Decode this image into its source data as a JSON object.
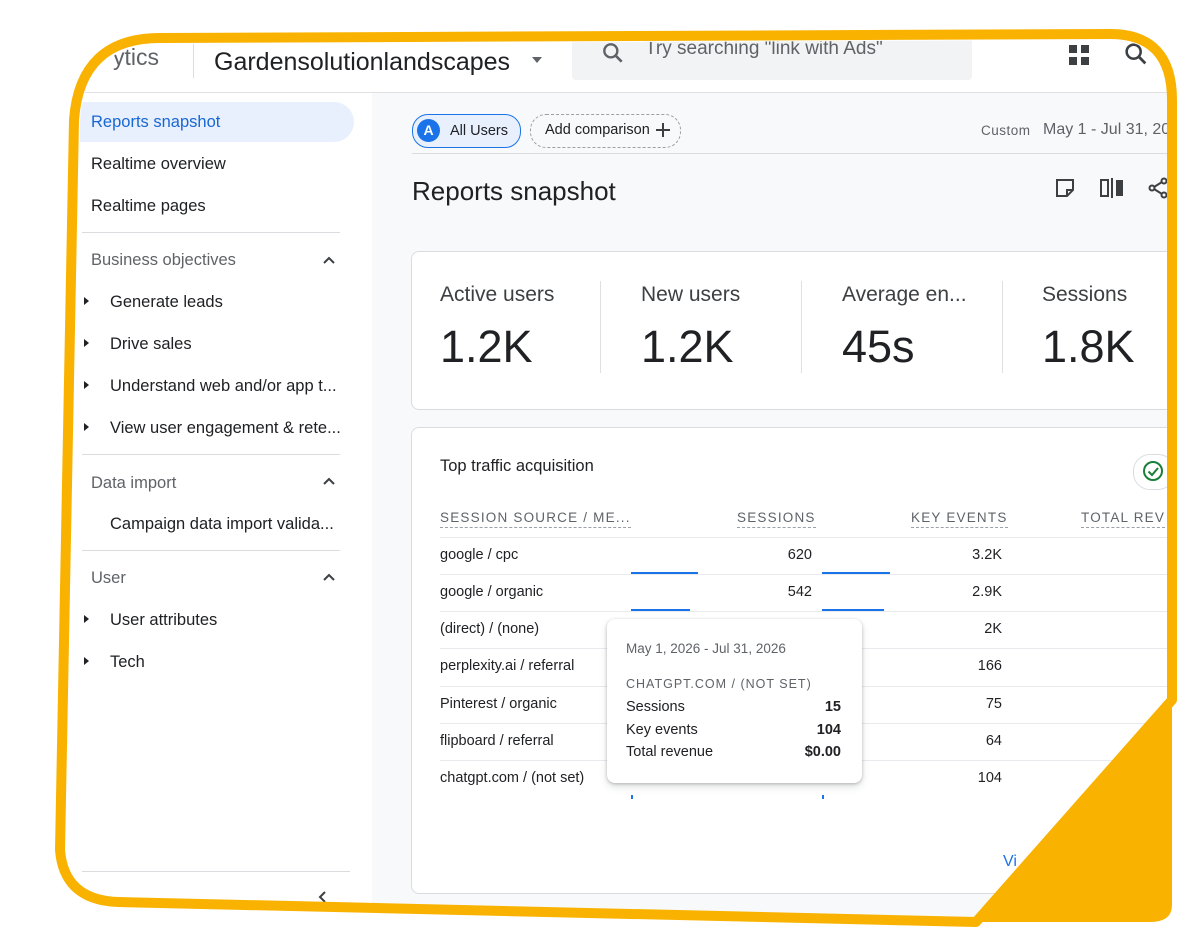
{
  "header": {
    "brand": "ytics",
    "property": "Gardensolutionlandscapes",
    "search_placeholder": "Try searching \"link with Ads\""
  },
  "sidebar": {
    "items": [
      "Reports snapshot",
      "Realtime overview",
      "Realtime pages"
    ],
    "sections": [
      {
        "title": "Business objectives",
        "items": [
          "Generate leads",
          "Drive sales",
          "Understand web and/or app t...",
          "View user engagement & rete..."
        ]
      },
      {
        "title": "Data import",
        "items": [
          "Campaign data import valida..."
        ]
      },
      {
        "title": "User",
        "items": [
          "User attributes",
          "Tech"
        ]
      }
    ]
  },
  "toolbar": {
    "all_users": "All Users",
    "avatar_letter": "A",
    "add_comparison": "Add comparison",
    "custom": "Custom",
    "date_range": "May 1 - Jul 31, 20"
  },
  "page_title": "Reports snapshot",
  "metrics": [
    {
      "label": "Active users",
      "value": "1.2K"
    },
    {
      "label": "New users",
      "value": "1.2K"
    },
    {
      "label": "Average en...",
      "value": "45s"
    },
    {
      "label": "Sessions",
      "value": "1.8K"
    }
  ],
  "traffic": {
    "title": "Top traffic acquisition",
    "columns": [
      "SESSION SOURCE / ME...",
      "SESSIONS",
      "KEY EVENTS",
      "TOTAL REV"
    ],
    "rows": [
      {
        "source": "google / cpc",
        "sessions": "620",
        "key_events": "3.2K"
      },
      {
        "source": "google / organic",
        "sessions": "542",
        "key_events": "2.9K"
      },
      {
        "source": "(direct) / (none)",
        "sessions": "",
        "key_events": "2K"
      },
      {
        "source": "perplexity.ai / referral",
        "sessions": "",
        "key_events": "166"
      },
      {
        "source": "Pinterest / organic",
        "sessions": "",
        "key_events": "75"
      },
      {
        "source": "flipboard / referral",
        "sessions": "",
        "key_events": "64"
      },
      {
        "source": "chatgpt.com / (not set)",
        "sessions": "",
        "key_events": "104"
      }
    ],
    "view_link": "Vi"
  },
  "tooltip": {
    "date": "May 1, 2026 - Jul 31, 2026",
    "source": "CHATGPT.COM / (NOT SET)",
    "rows": [
      {
        "label": "Sessions",
        "value": "15"
      },
      {
        "label": "Key events",
        "value": "104"
      },
      {
        "label": "Total revenue",
        "value": "$0.00"
      }
    ]
  },
  "colors": {
    "accent": "#1a73e8",
    "frame": "#f9b200",
    "active_bg": "#e8f0fe"
  }
}
